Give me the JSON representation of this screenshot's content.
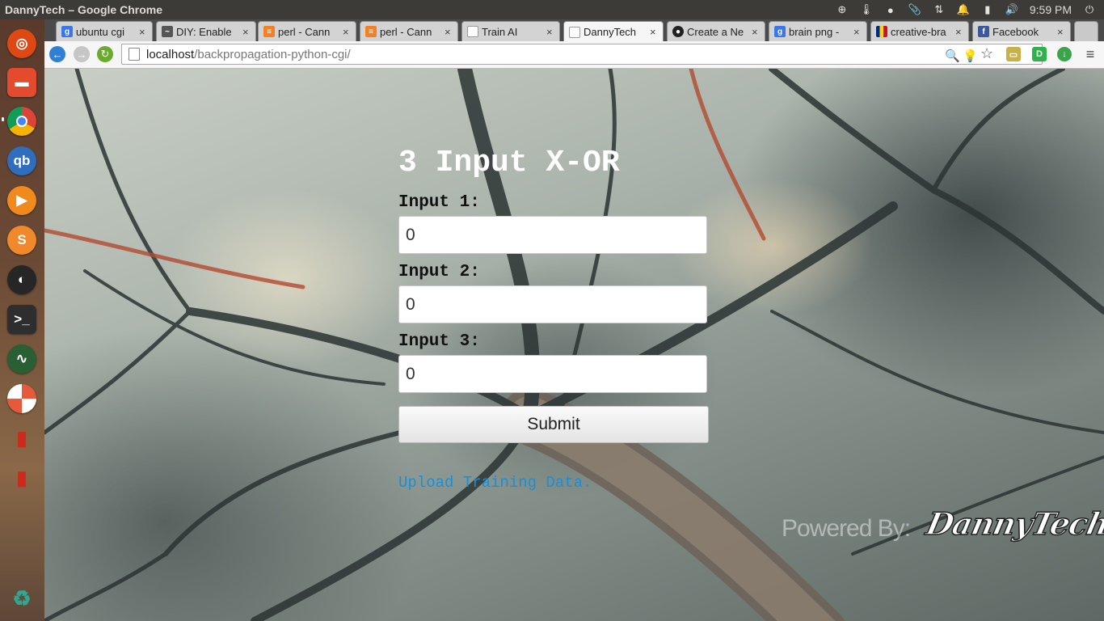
{
  "window": {
    "title": "DannyTech – Google Chrome"
  },
  "system_tray": {
    "clock": "9:59 PM"
  },
  "tabs": [
    {
      "label": "ubuntu cgi",
      "favicon": "google-icon",
      "color": "#3b78e7"
    },
    {
      "label": "DIY: Enable",
      "favicon": "diy-icon",
      "color": "#555555"
    },
    {
      "label": "perl - Cann",
      "favicon": "stackoverflow-icon",
      "color": "#f48024"
    },
    {
      "label": "perl - Cann",
      "favicon": "stackoverflow-icon",
      "color": "#f48024"
    },
    {
      "label": "Train AI",
      "favicon": "page-icon",
      "color": "#999999"
    },
    {
      "label": "DannyTech",
      "favicon": "page-icon",
      "color": "#999999",
      "active": true
    },
    {
      "label": "Create a Ne",
      "favicon": "github-icon",
      "color": "#222222"
    },
    {
      "label": "brain png -",
      "favicon": "google-icon",
      "color": "#3b78e7"
    },
    {
      "label": "creative-bra",
      "favicon": "romania-flag-icon",
      "color": "#fcd116"
    },
    {
      "label": "Facebook",
      "favicon": "facebook-icon",
      "color": "#3b5998"
    }
  ],
  "omnibox": {
    "host": "localhost",
    "path": "/backpropagation-python-cgi/"
  },
  "page": {
    "title": "3 Input X-OR",
    "inputs": [
      {
        "label": "Input 1:",
        "value": "0"
      },
      {
        "label": "Input 2:",
        "value": "0"
      },
      {
        "label": "Input 3:",
        "value": "0"
      }
    ],
    "submit_label": "Submit",
    "upload_link": "Upload Training Data.",
    "powered_by": "Powered By:",
    "brand": "DannyTech"
  },
  "launcher": [
    {
      "name": "ubuntu-home-icon",
      "color": "#dd4814"
    },
    {
      "name": "files-icon",
      "color": "#e24b2e"
    },
    {
      "name": "chrome-icon",
      "color": "#e8e8e8"
    },
    {
      "name": "qbittorrent-icon",
      "color": "#2f6ebf"
    },
    {
      "name": "media-player-icon",
      "color": "#f08a1c"
    },
    {
      "name": "sublime-text-icon",
      "color": "#f0892c"
    },
    {
      "name": "app-icon",
      "color": "#262626"
    },
    {
      "name": "terminal-icon",
      "color": "#2e2e2e"
    },
    {
      "name": "system-monitor-icon",
      "color": "#2a5f33"
    },
    {
      "name": "disk-icon",
      "color": "#e55a3b"
    },
    {
      "name": "fire-extinguisher-icon",
      "color": "#cc2a1c"
    },
    {
      "name": "fire-extinguisher-icon",
      "color": "#cc2a1c"
    },
    {
      "name": "trash-icon",
      "color": "#2a8c7a"
    }
  ]
}
